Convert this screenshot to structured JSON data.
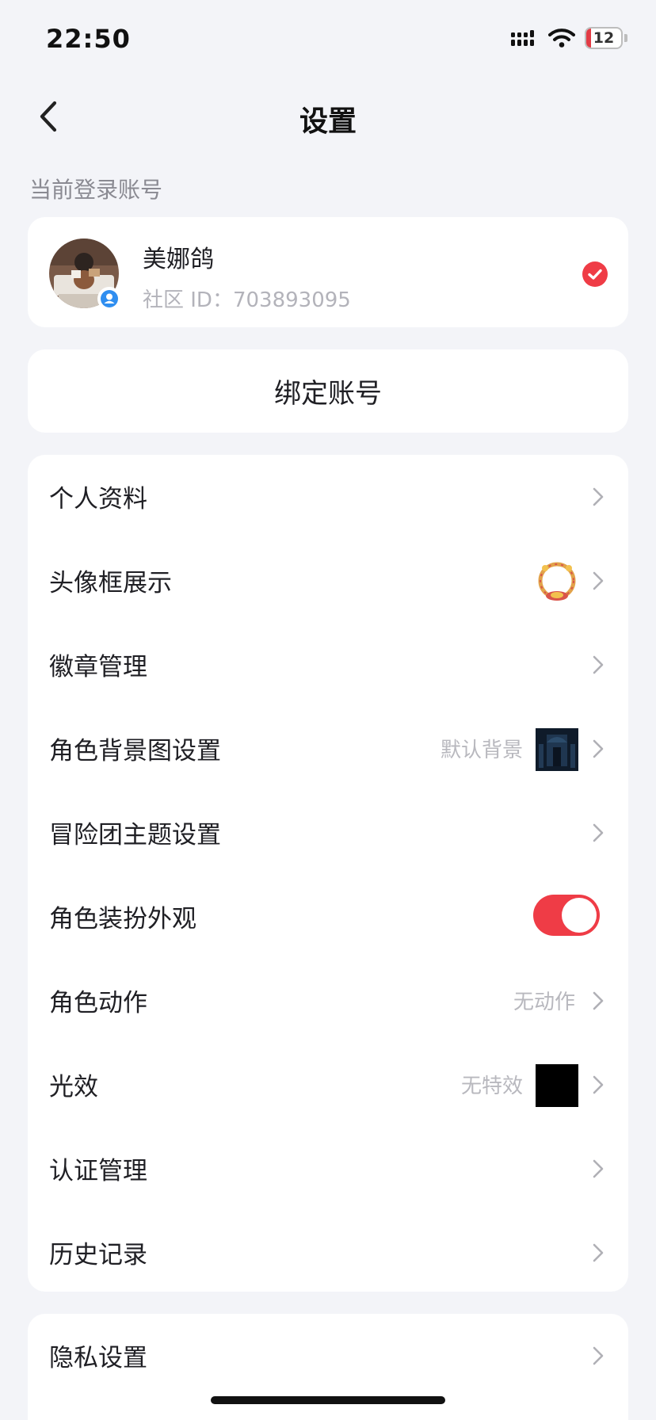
{
  "status_bar": {
    "time": "22:50",
    "battery": "12",
    "icons": [
      "signal-icon",
      "wifi-icon",
      "battery-icon"
    ]
  },
  "nav": {
    "title": "设置",
    "back_icon": "chevron-left-icon"
  },
  "account_section": {
    "label": "当前登录账号",
    "name": "美娜鸽",
    "community_id": "社区 ID：703893095",
    "selected": true
  },
  "bind_account": {
    "label": "绑定账号"
  },
  "settings": [
    {
      "label": "个人资料"
    },
    {
      "label": "头像框展示",
      "thumb": "avatar-frame"
    },
    {
      "label": "徽章管理"
    },
    {
      "label": "角色背景图设置",
      "value": "默认背景",
      "thumb": "background"
    },
    {
      "label": "冒险团主题设置"
    },
    {
      "label": "角色装扮外观",
      "toggle": true
    },
    {
      "label": "角色动作",
      "value": "无动作"
    },
    {
      "label": "光效",
      "value": "无特效",
      "thumb": "black"
    },
    {
      "label": "认证管理"
    },
    {
      "label": "历史记录"
    }
  ],
  "privacy": {
    "label": "隐私设置"
  },
  "colors": {
    "accent": "#ef3c46",
    "background": "#f3f4f8",
    "card": "#ffffff",
    "secondary_text": "#b8b8be"
  }
}
